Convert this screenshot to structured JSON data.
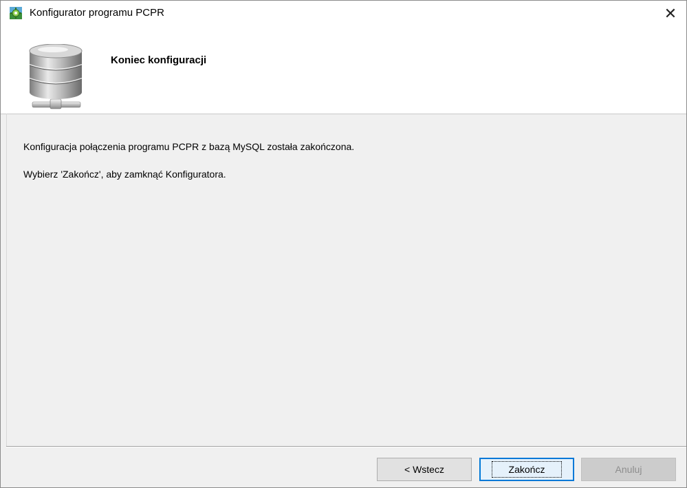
{
  "window": {
    "title": "Konfigurator programu PCPR",
    "close_glyph": "✕"
  },
  "header": {
    "title": "Koniec konfiguracji",
    "icon": "database-network-icon"
  },
  "content": {
    "line1": "Konfiguracja połączenia programu PCPR z bazą MySQL została zakończona.",
    "line2": "Wybierz 'Zakończ', aby zamknąć Konfiguratora."
  },
  "buttons": {
    "back": "< Wstecz",
    "finish": "Zakończ",
    "cancel": "Anuluj"
  },
  "colors": {
    "accent": "#0078d7",
    "dialog_bg": "#f0f0f0",
    "header_bg": "#ffffff"
  }
}
